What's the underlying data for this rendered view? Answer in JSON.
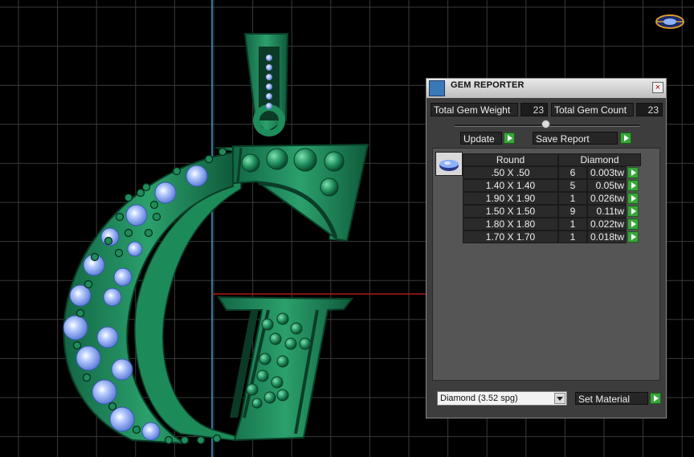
{
  "panel": {
    "title": "GEM REPORTER",
    "close_label": "×",
    "total_weight_label": "Total Gem Weight",
    "total_weight_value": "23",
    "total_count_label": "Total Gem Count",
    "total_count_value": "23",
    "update_label": "Update",
    "save_report_label": "Save Report",
    "table": {
      "col_cut": "Round",
      "col_material": "Diamond",
      "rows": [
        {
          "size": ".50 X .50",
          "count": "6",
          "weight": "0.003tw"
        },
        {
          "size": "1.40 X 1.40",
          "count": "5",
          "weight": "0.05tw"
        },
        {
          "size": "1.90 X 1.90",
          "count": "1",
          "weight": "0.026tw"
        },
        {
          "size": "1.50 X 1.50",
          "count": "9",
          "weight": "0.11tw"
        },
        {
          "size": "1.80 X 1.80",
          "count": "1",
          "weight": "0.022tw"
        },
        {
          "size": "1.70 X 1.70",
          "count": "1",
          "weight": "0.018tw"
        }
      ]
    },
    "material_select": "Diamond     (3.52 spg)",
    "set_material_label": "Set Material"
  },
  "colors": {
    "metal": "#1f8c5c",
    "gem": "#8fb2ff",
    "grid": "#3a3a3a",
    "accent_green": "#3aa53a"
  }
}
